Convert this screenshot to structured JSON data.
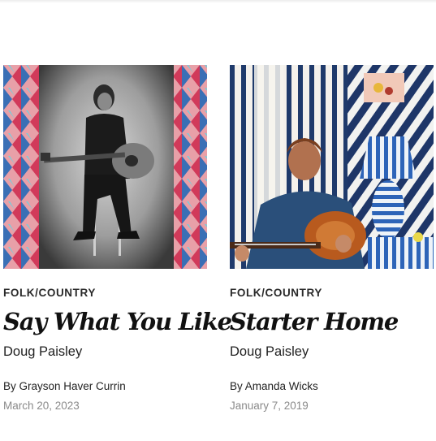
{
  "reviews": [
    {
      "genre": "FOLK/COUNTRY",
      "title": "Say What You Like",
      "artist": "Doug Paisley",
      "byline": "By Grayson Haver Currin",
      "date": "March 20, 2023",
      "art_icon": "album-cover-guitarist-bw-photo"
    },
    {
      "genre": "FOLK/COUNTRY",
      "title": "Starter Home",
      "artist": "Doug Paisley",
      "byline": "By Amanda Wicks",
      "date": "January 7, 2019",
      "art_icon": "album-cover-guitarist-striped-room"
    }
  ],
  "colors": {
    "text": "#111111",
    "date": "#8a8a8a",
    "stripe_blue": "#1f3a6b"
  }
}
